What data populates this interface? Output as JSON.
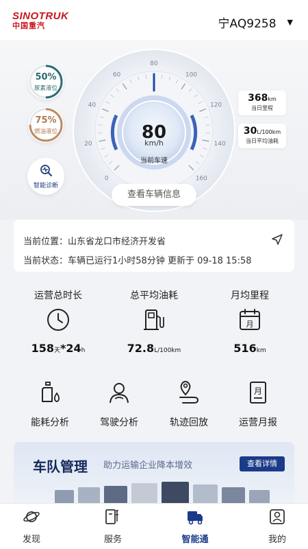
{
  "brand": {
    "name_en": "SINOTRUK",
    "name_cn": "中国重汽"
  },
  "header": {
    "plate": "宁AQ9258"
  },
  "gauge": {
    "speed": "80",
    "unit": "km/h",
    "label": "当前车速",
    "ticks": [
      "0",
      "20",
      "40",
      "60",
      "80",
      "100",
      "120",
      "140",
      "160"
    ],
    "max": 160,
    "value": 80
  },
  "levels": {
    "urea": {
      "percent": "50%",
      "label": "尿素液位",
      "value": 0.5,
      "color": "#2c6c72"
    },
    "fuel": {
      "percent": "75%",
      "label": "燃油液位",
      "value": 0.75,
      "color": "#c08a60"
    }
  },
  "diagnosis": {
    "label": "智能诊断"
  },
  "side_stats": {
    "mileage": {
      "value": "368",
      "unit": "km",
      "label": "当日里程"
    },
    "fuel": {
      "value": "30",
      "unit": "L/100km",
      "label": "当日平均油耗"
    }
  },
  "view_vehicle": "查看车辆信息",
  "info": {
    "location_label": "当前位置：",
    "location": "山东省龙口市经济开发省",
    "status_label": "当前状态：",
    "status": "车辆已运行1小时58分钟",
    "updated": "更新于 09-18 15:58"
  },
  "metrics": [
    {
      "title": "运营总时长",
      "value_a": "158",
      "unit_a": "天",
      "value_b": "*24",
      "unit_b": "h",
      "icon": "clock-icon"
    },
    {
      "title": "总平均油耗",
      "value_a": "72.8",
      "unit_a": "L/100km",
      "icon": "fuel-pump-icon"
    },
    {
      "title": "月均里程",
      "value_a": "516",
      "unit_a": "km",
      "icon": "calendar-icon"
    }
  ],
  "actions": [
    {
      "label": "能耗分析",
      "icon": "oil-bottle-icon"
    },
    {
      "label": "驾驶分析",
      "icon": "driver-icon"
    },
    {
      "label": "轨迹回放",
      "icon": "route-pin-icon"
    },
    {
      "label": "运营月报",
      "icon": "report-icon"
    }
  ],
  "fleet": {
    "title": "车队管理",
    "subtitle": "助力运输企业降本增效",
    "button": "查看详情"
  },
  "tabs": [
    {
      "label": "发现",
      "icon": "planet-icon",
      "active": false
    },
    {
      "label": "服务",
      "icon": "service-icon",
      "active": false
    },
    {
      "label": "智能通",
      "icon": "truck-icon",
      "active": true
    },
    {
      "label": "我的",
      "icon": "profile-icon",
      "active": false
    }
  ],
  "colors": {
    "brand_red": "#c8171e",
    "navy": "#1a3a8a",
    "gauge_blue": "#3b63b8"
  }
}
